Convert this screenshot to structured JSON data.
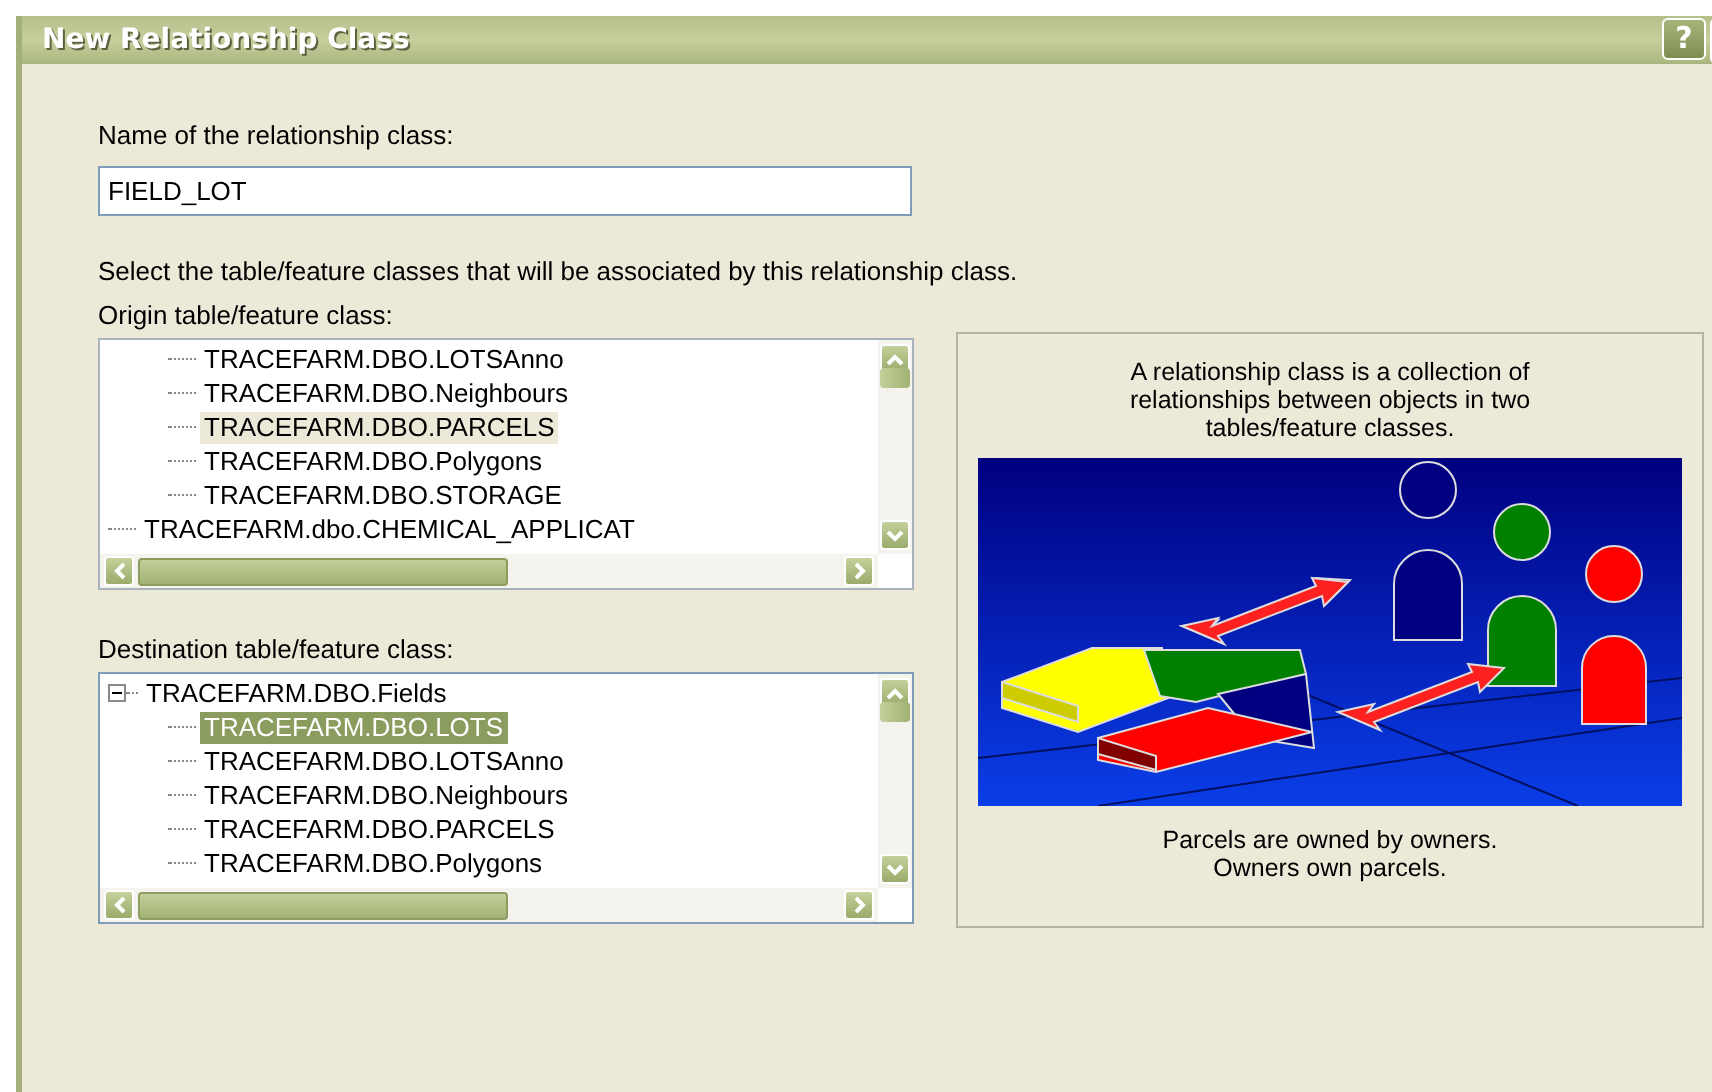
{
  "window": {
    "title": "New Relationship Class",
    "buttons": [
      "?"
    ]
  },
  "name_field": {
    "label": "Name of the relationship class:",
    "value": "FIELD_LOT"
  },
  "instruction": "Select the table/feature classes that will be associated by this relationship class.",
  "origin": {
    "label": "Origin table/feature class:",
    "focused": false,
    "tree": [
      {
        "children": [
          {
            "label": "TRACEFARM.DBO.LOTSAnno",
            "selected": false
          },
          {
            "label": "TRACEFARM.DBO.Neighbours",
            "selected": false
          },
          {
            "label": "TRACEFARM.DBO.PARCELS",
            "selected": true
          },
          {
            "label": "TRACEFARM.DBO.Polygons",
            "selected": false
          },
          {
            "label": "TRACEFARM.DBO.STORAGE",
            "selected": false
          }
        ]
      },
      {
        "label": "TRACEFARM.dbo.CHEMICAL_APPLICAT",
        "selected": false
      }
    ]
  },
  "destination": {
    "label": "Destination table/feature class:",
    "focused": true,
    "tree": [
      {
        "label": "TRACEFARM.DBO.Fields",
        "selected": false,
        "expanded": true,
        "children": [
          {
            "label": "TRACEFARM.DBO.LOTS",
            "selected": true
          },
          {
            "label": "TRACEFARM.DBO.LOTSAnno",
            "selected": false
          },
          {
            "label": "TRACEFARM.DBO.Neighbours",
            "selected": false
          },
          {
            "label": "TRACEFARM.DBO.PARCELS",
            "selected": false
          },
          {
            "label": "TRACEFARM.DBO.Polygons",
            "selected": false
          }
        ]
      }
    ]
  },
  "info": {
    "description": "A relationship class is a collection of relationships between objects in two tables/feature classes.",
    "caption": [
      "Parcels are owned by owners.",
      "Owners own parcels."
    ]
  }
}
